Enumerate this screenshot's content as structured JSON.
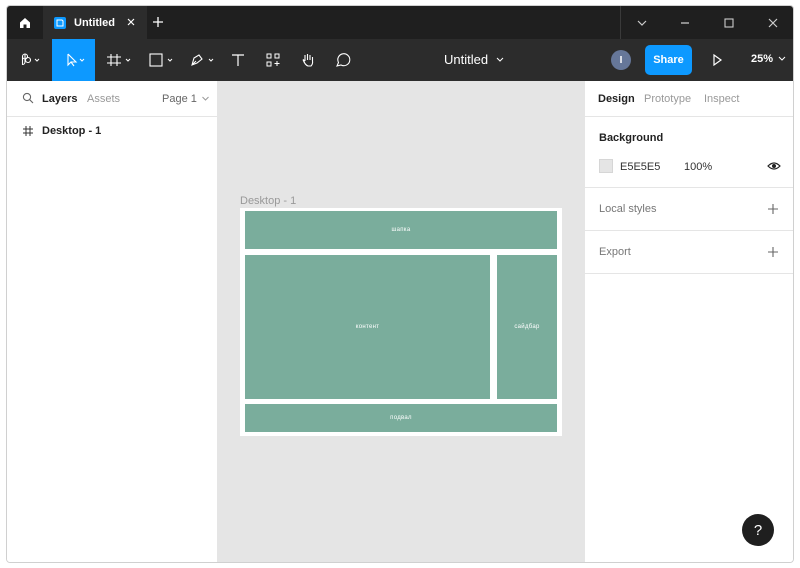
{
  "titlebar": {
    "tab_title": "Untitled"
  },
  "toolbar": {
    "doc_title": "Untitled",
    "avatar_initial": "I",
    "share_label": "Share",
    "zoom": "25%"
  },
  "left_panel": {
    "tabs": [
      "Layers",
      "Assets"
    ],
    "page": "Page 1",
    "layers": [
      "Desktop - 1"
    ]
  },
  "canvas": {
    "frame_label": "Desktop - 1",
    "blocks": {
      "header": "шапка",
      "content": "контент",
      "sidebar": "сайдбар",
      "footer": "подвал"
    }
  },
  "right_panel": {
    "tabs": [
      "Design",
      "Prototype",
      "Inspect"
    ],
    "background_title": "Background",
    "background_hex": "E5E5E5",
    "background_opacity": "100%",
    "local_styles": "Local styles",
    "export": "Export"
  },
  "help_label": "?",
  "colors": {
    "accent": "#0d99ff",
    "block": "#7aad9c",
    "canvas": "#e5e5e5",
    "chrome": "#2c2c2c"
  }
}
